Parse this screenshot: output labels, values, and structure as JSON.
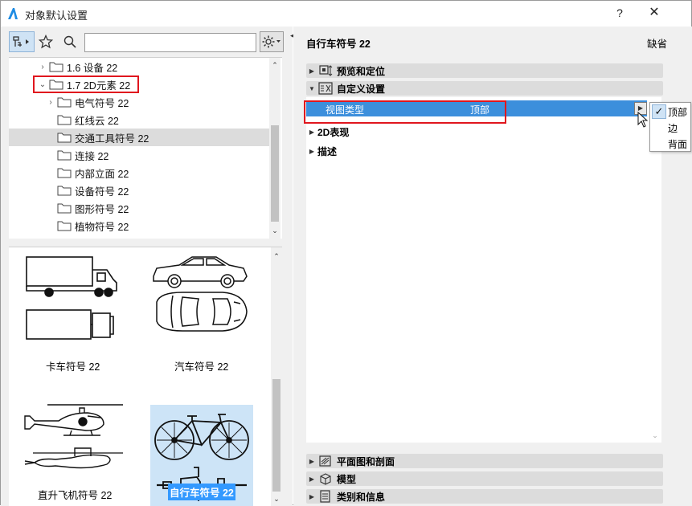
{
  "window": {
    "title": "对象默认设置",
    "help_label": "?",
    "close_label": "✕"
  },
  "left": {
    "toolbar": {
      "tree_view_icon": "object-tree-icon",
      "favorites_icon": "star-icon",
      "search_icon": "search-icon",
      "settings_icon": "gear-icon"
    },
    "search": {
      "value": "",
      "placeholder": ""
    },
    "tree": [
      {
        "label": "1.6 设备 22",
        "expanded": false,
        "has_children": true
      },
      {
        "label": "1.7 2D元素 22",
        "expanded": true,
        "has_children": true
      },
      {
        "label": "电气符号 22",
        "expanded": false,
        "has_children": true
      },
      {
        "label": "红线云 22",
        "expanded": false,
        "has_children": false
      },
      {
        "label": "交通工具符号 22",
        "expanded": false,
        "has_children": false,
        "selected": true
      },
      {
        "label": "连接 22",
        "expanded": false,
        "has_children": false
      },
      {
        "label": "内部立面 22",
        "expanded": false,
        "has_children": false
      },
      {
        "label": "设备符号 22",
        "expanded": false,
        "has_children": false
      },
      {
        "label": "图形符号 22",
        "expanded": false,
        "has_children": false
      },
      {
        "label": "植物符号 22",
        "expanded": false,
        "has_children": false
      }
    ],
    "previews": [
      {
        "label": "卡车符号 22",
        "icon": "truck-icon",
        "selected": false
      },
      {
        "label": "汽车符号 22",
        "icon": "car-icon",
        "selected": false
      },
      {
        "label": "直升飞机符号 22",
        "icon": "helicopter-icon",
        "selected": false
      },
      {
        "label": "自行车符号 22",
        "icon": "bicycle-icon",
        "selected": true
      }
    ]
  },
  "right": {
    "object_title": "自行车符号 22",
    "default_label": "缺省",
    "sections_top": [
      {
        "label": "预览和定位",
        "icon": "preview-position-icon",
        "expanded": false
      },
      {
        "label": "自定义设置",
        "icon": "custom-settings-icon",
        "expanded": true
      }
    ],
    "property": {
      "name": "视图类型",
      "value": "顶部"
    },
    "subsections": [
      {
        "label": "2D表现"
      },
      {
        "label": "描述"
      }
    ],
    "sections_bottom": [
      {
        "label": "平面图和剖面",
        "icon": "floor-plan-icon"
      },
      {
        "label": "模型",
        "icon": "model-cube-icon"
      },
      {
        "label": "类别和信息",
        "icon": "classification-icon"
      }
    ],
    "dropdown": {
      "options": [
        "顶部",
        "边",
        "背面"
      ],
      "selected": "顶部"
    }
  },
  "colors": {
    "selection_blue": "#3c8fdc",
    "highlight_red": "#e0161e",
    "panel_bg": "#f0f0f0",
    "section_bg": "#dcdcdc"
  }
}
